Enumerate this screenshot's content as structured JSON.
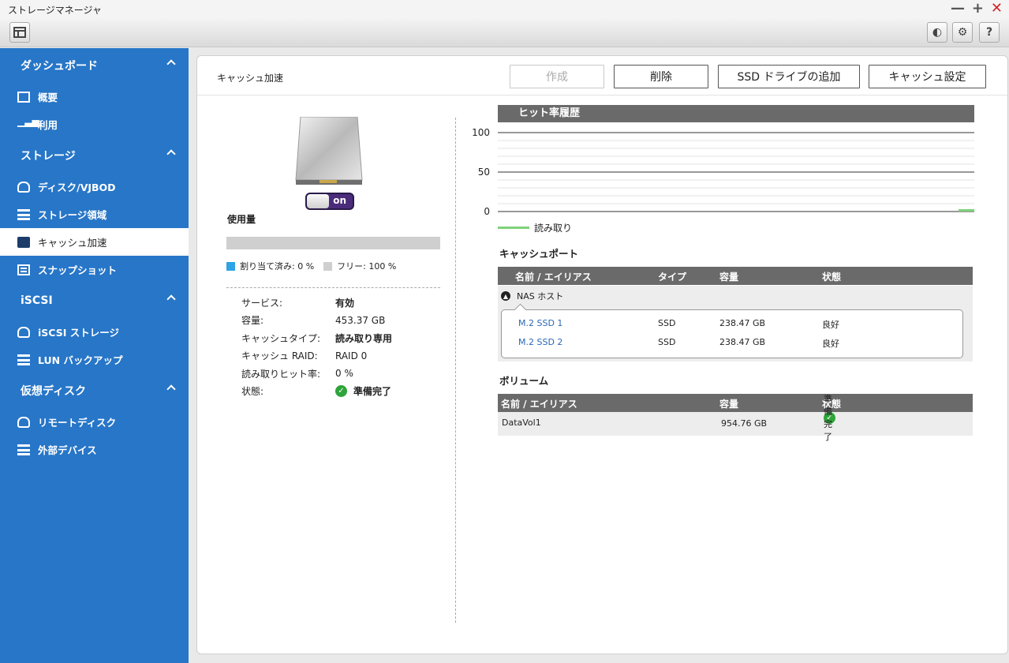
{
  "window": {
    "title": "ストレージマネージャ",
    "min": "—",
    "max": "+",
    "close": "✕"
  },
  "toolbar": {
    "b1": "◐",
    "b2": "⚙",
    "b3": "?"
  },
  "sidebar": {
    "sections": [
      {
        "label": "ダッシュボード",
        "items": [
          {
            "label": "概要",
            "icon": "overview-icon"
          },
          {
            "label": "利用",
            "icon": "usage-icon"
          }
        ]
      },
      {
        "label": "ストレージ",
        "items": [
          {
            "label": "ディスク/VJBOD",
            "icon": "disk-icon"
          },
          {
            "label": "ストレージ領域",
            "icon": "storage-space-icon"
          },
          {
            "label": "キャッシュ加速",
            "icon": "cache-icon",
            "active": true
          },
          {
            "label": "スナップショット",
            "icon": "snapshot-icon"
          }
        ]
      },
      {
        "label": "iSCSI",
        "items": [
          {
            "label": "iSCSI ストレージ",
            "icon": "iscsi-storage-icon"
          },
          {
            "label": "LUN バックアップ",
            "icon": "lun-backup-icon"
          }
        ]
      },
      {
        "label": "仮想ディスク",
        "items": [
          {
            "label": "リモートディスク",
            "icon": "remote-disk-icon"
          },
          {
            "label": "外部デバイス",
            "icon": "external-device-icon"
          }
        ]
      }
    ]
  },
  "panel": {
    "title": "キャッシュ加速",
    "buttons": {
      "create": "作成",
      "delete": "削除",
      "add_ssd": "SSD ドライブの追加",
      "settings": "キャッシュ設定"
    },
    "toggle": "on",
    "usage": {
      "label": "使用量",
      "allocated_fraction": 0.0,
      "allocated": "割り当て済み: 0 %",
      "free": "フリー: 100 %",
      "allocated_color": "#2ea3e6",
      "free_color": "#cfcfcf"
    },
    "info": {
      "service_k": "サービス:",
      "service_v": "有効",
      "capacity_k": "容量:",
      "capacity_v": "453.37 GB",
      "type_k": "キャッシュタイプ:",
      "type_v": "読み取り専用",
      "raid_k": "キャッシュ RAID:",
      "raid_v": "RAID 0",
      "hit_k": "読み取りヒット率:",
      "hit_v": "0 %",
      "status_k": "状態:",
      "status_v": "準備完了"
    }
  },
  "chart_data": {
    "type": "line",
    "title": "ヒット率履歴",
    "ylim": [
      0,
      100
    ],
    "yticks": [
      "100",
      "50",
      "0"
    ],
    "series": [
      {
        "name": "読み取り",
        "values": [
          0,
          0,
          0,
          0,
          0,
          0,
          0,
          0,
          0,
          0,
          0,
          0,
          0,
          0,
          0,
          0,
          0,
          0,
          0,
          0,
          0,
          0,
          0,
          0,
          1
        ],
        "color": "#7ed27a"
      }
    ],
    "grid": true,
    "legend": "bottom-left"
  },
  "cache_port": {
    "title": "キャッシュポート",
    "headers": {
      "name": "名前 / エイリアス",
      "type": "タイプ",
      "capacity": "容量",
      "status": "状態"
    },
    "group": "NAS ホスト",
    "rows": [
      {
        "name": "M.2 SSD 1",
        "type": "SSD",
        "capacity": "238.47 GB",
        "status": "良好"
      },
      {
        "name": "M.2 SSD 2",
        "type": "SSD",
        "capacity": "238.47 GB",
        "status": "良好"
      }
    ]
  },
  "volume": {
    "title": "ボリューム",
    "headers": {
      "name": "名前 / エイリアス",
      "capacity": "容量",
      "status": "状態"
    },
    "rows": [
      {
        "name": "DataVol1",
        "capacity": "954.76 GB",
        "status": "準備完了"
      }
    ]
  }
}
